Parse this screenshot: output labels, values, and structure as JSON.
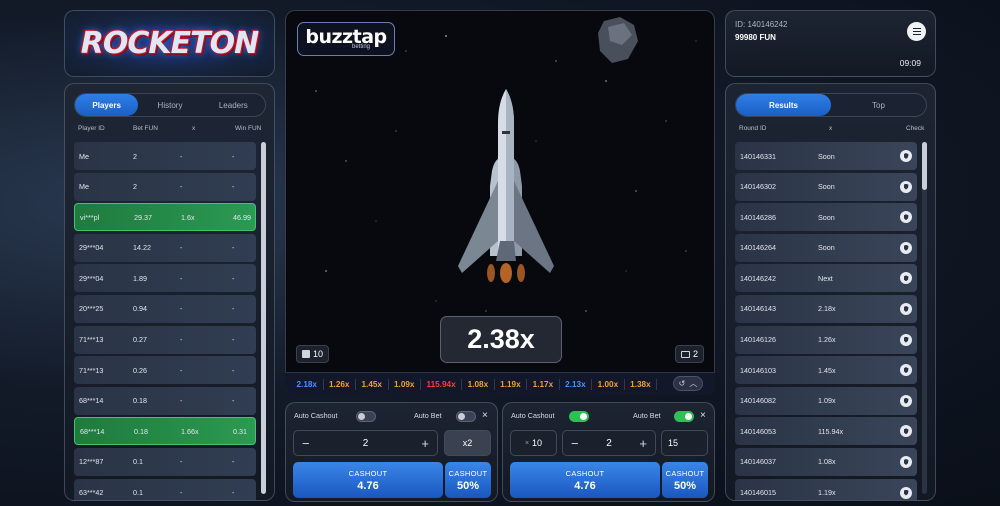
{
  "logo": {
    "text": "ROCKETON"
  },
  "players": {
    "tabs": [
      "Players",
      "History",
      "Leaders"
    ],
    "active_tab": 0,
    "columns": {
      "id": "Player ID",
      "bet": "Bet FUN",
      "x": "x",
      "win": "Win FUN"
    },
    "rows": [
      {
        "id": "Me",
        "bet": "2",
        "x": "-",
        "win": "-",
        "win_row": false
      },
      {
        "id": "Me",
        "bet": "2",
        "x": "-",
        "win": "-",
        "win_row": false
      },
      {
        "id": "vi***pl",
        "bet": "29.37",
        "x": "1.6x",
        "win": "46.99",
        "win_row": true
      },
      {
        "id": "29***04",
        "bet": "14.22",
        "x": "-",
        "win": "-",
        "win_row": false
      },
      {
        "id": "29***04",
        "bet": "1.89",
        "x": "-",
        "win": "-",
        "win_row": false
      },
      {
        "id": "20***25",
        "bet": "0.94",
        "x": "-",
        "win": "-",
        "win_row": false
      },
      {
        "id": "71***13",
        "bet": "0.27",
        "x": "-",
        "win": "-",
        "win_row": false
      },
      {
        "id": "71***13",
        "bet": "0.26",
        "x": "-",
        "win": "-",
        "win_row": false
      },
      {
        "id": "68***14",
        "bet": "0.18",
        "x": "-",
        "win": "-",
        "win_row": false
      },
      {
        "id": "68***14",
        "bet": "0.18",
        "x": "1.66x",
        "win": "0.31",
        "win_row": true
      },
      {
        "id": "12***87",
        "bet": "0.1",
        "x": "-",
        "win": "-",
        "win_row": false
      },
      {
        "id": "63***42",
        "bet": "0.1",
        "x": "-",
        "win": "-",
        "win_row": false
      }
    ]
  },
  "game": {
    "brand_main": "buzztap",
    "brand_sub": "betting",
    "multiplier": "2.38x",
    "players_count": "10",
    "bets_count": "2",
    "history": [
      {
        "v": "2.18x",
        "c": "#4a90ff"
      },
      {
        "v": "1.26x",
        "c": "#f0a030"
      },
      {
        "v": "1.45x",
        "c": "#f0a030"
      },
      {
        "v": "1.09x",
        "c": "#f0a030"
      },
      {
        "v": "115.94x",
        "c": "#ff3b3b"
      },
      {
        "v": "1.08x",
        "c": "#f0a030"
      },
      {
        "v": "1.19x",
        "c": "#f0a030"
      },
      {
        "v": "1.17x",
        "c": "#f0a030"
      },
      {
        "v": "2.13x",
        "c": "#4a90ff"
      },
      {
        "v": "1.00x",
        "c": "#f0a030"
      },
      {
        "v": "1.38x",
        "c": "#f0a030"
      }
    ]
  },
  "bet1": {
    "auto_cashout_label": "Auto Cashout",
    "auto_bet_label": "Auto Bet",
    "auto_cashout_on": false,
    "auto_bet_on": false,
    "amount": "2",
    "multiplier_btn": "x2",
    "cashout_label": "CASHOUT",
    "cashout_value": "4.76",
    "cashout_pct_label": "CASHOUT",
    "cashout_pct": "50%"
  },
  "bet2": {
    "auto_cashout_label": "Auto Cashout",
    "auto_bet_label": "Auto Bet",
    "auto_cashout_on": true,
    "auto_bet_on": true,
    "auto_x": "10",
    "amount": "2",
    "rounds": "15",
    "cashout_label": "CASHOUT",
    "cashout_value": "4.76",
    "cashout_pct_label": "CASHOUT",
    "cashout_pct": "50%"
  },
  "info": {
    "id": "ID: 140146242",
    "balance": "99980 FUN",
    "time": "09:09"
  },
  "results": {
    "tabs": [
      "Results",
      "Top"
    ],
    "active_tab": 0,
    "columns": {
      "round": "Round ID",
      "x": "x",
      "check": "Check"
    },
    "rows": [
      {
        "id": "140146331",
        "x": "Soon"
      },
      {
        "id": "140146302",
        "x": "Soon"
      },
      {
        "id": "140146286",
        "x": "Soon"
      },
      {
        "id": "140146264",
        "x": "Soon"
      },
      {
        "id": "140146242",
        "x": "Next"
      },
      {
        "id": "140146143",
        "x": "2.18x"
      },
      {
        "id": "140146126",
        "x": "1.26x"
      },
      {
        "id": "140146103",
        "x": "1.45x"
      },
      {
        "id": "140146082",
        "x": "1.09x"
      },
      {
        "id": "140146053",
        "x": "115.94x"
      },
      {
        "id": "140146037",
        "x": "1.08x"
      },
      {
        "id": "140146015",
        "x": "1.19x"
      }
    ]
  }
}
